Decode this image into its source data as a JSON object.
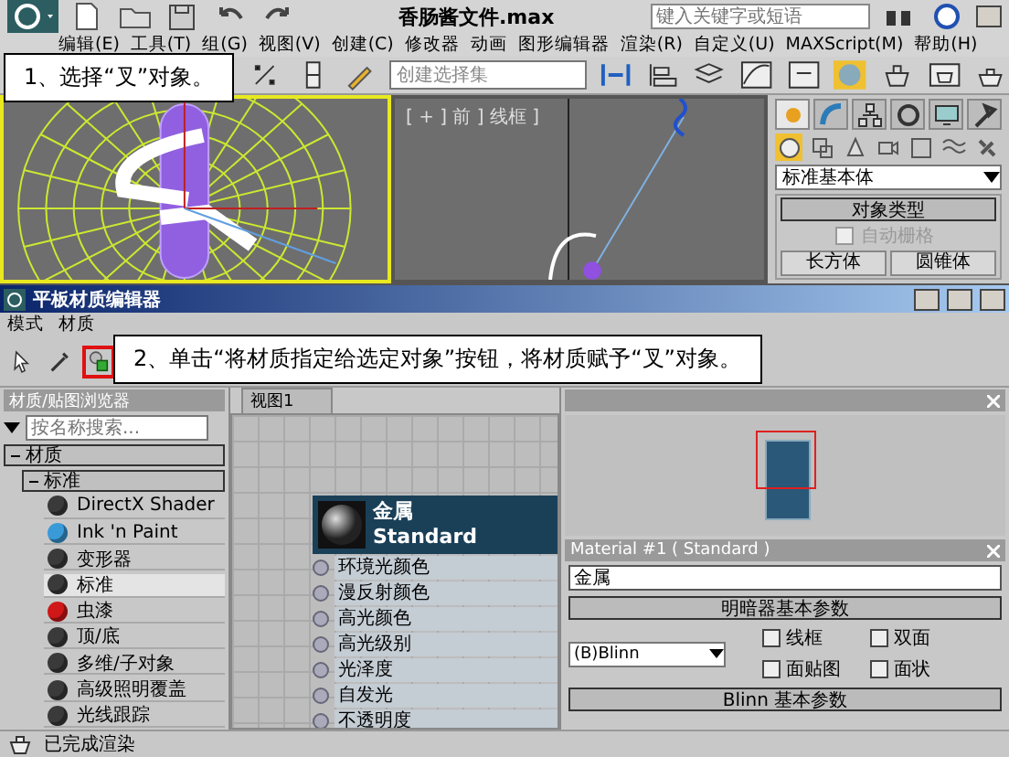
{
  "app_window": {
    "title": "香肠酱文件.max",
    "search": {
      "placeholder": "键入关键字或短语"
    },
    "menu": [
      "编辑(E)",
      "工具(T)",
      "组(G)",
      "视图(V)",
      "创建(C)",
      "修改器",
      "动画",
      "图形编辑器",
      "渲染(R)",
      "自定义(U)",
      "MAXScript(M)",
      "帮助(H)"
    ],
    "selection_set": {
      "placeholder": "创建选择集"
    }
  },
  "viewports": [
    {
      "kind": "perspective",
      "selected": true
    },
    {
      "kind": "front",
      "label": "[ + ] 前 ] 线框 ]",
      "selected": false
    }
  ],
  "command_panel": {
    "tabs": [
      {
        "kind": "create",
        "selected": true
      },
      {
        "kind": "modify",
        "selected": false
      },
      {
        "kind": "hierarchy",
        "selected": false
      },
      {
        "kind": "motion",
        "selected": false
      },
      {
        "kind": "display",
        "selected": false
      },
      {
        "kind": "utilities",
        "selected": false
      }
    ],
    "categories": [
      {
        "kind": "geometry",
        "selected": true
      },
      {
        "kind": "shapes",
        "selected": false
      },
      {
        "kind": "lights",
        "selected": false
      },
      {
        "kind": "cameras",
        "selected": false
      },
      {
        "kind": "helpers",
        "selected": false
      },
      {
        "kind": "spacewarps",
        "selected": false
      },
      {
        "kind": "systems",
        "selected": false
      }
    ],
    "dropdown": "标准基本体",
    "rollout": {
      "title": "对象类型",
      "auto_grid": {
        "label": "自动栅格",
        "checked": false,
        "disabled": true
      },
      "buttons": [
        "长方体",
        "圆锥体"
      ]
    }
  },
  "material_editor": {
    "title": "平板材质编辑器",
    "menu": [
      "模式",
      "材质"
    ],
    "toolbar": [
      {
        "kind": "select",
        "highlighted": false
      },
      {
        "kind": "picker",
        "highlighted": false
      },
      {
        "kind": "assign",
        "highlighted": true
      }
    ],
    "browser": {
      "title": "材质/贴图浏览器",
      "search": {
        "placeholder": "按名称搜索..."
      },
      "groups": [
        {
          "label": "材质",
          "expanded": true,
          "children": [
            {
              "label": "标准",
              "expanded": true,
              "children": [
                {
                  "label": "DirectX Shader",
                  "color": "#3a3a3a",
                  "selected": false
                },
                {
                  "label": "Ink 'n Paint",
                  "color": "#3a9ad8",
                  "selected": false
                },
                {
                  "label": "变形器",
                  "color": "#3a3a3a",
                  "selected": false
                },
                {
                  "label": "标准",
                  "color": "#3a3a3a",
                  "selected": true
                },
                {
                  "label": "虫漆",
                  "color": "#d01818",
                  "selected": false
                },
                {
                  "label": "顶/底",
                  "color": "#3a3a3a",
                  "selected": false
                },
                {
                  "label": "多维/子对象",
                  "color": "#3a3a3a",
                  "selected": false
                },
                {
                  "label": "高级照明覆盖",
                  "color": "#3a3a3a",
                  "selected": false
                },
                {
                  "label": "光线跟踪",
                  "color": "#3a3a3a",
                  "selected": false
                }
              ]
            }
          ]
        }
      ]
    },
    "view": {
      "tab": "视图1",
      "node": {
        "name": "金属",
        "type": "Standard",
        "slots": [
          "环境光颜色",
          "漫反射颜色",
          "高光颜色",
          "高光级别",
          "光泽度",
          "自发光",
          "不透明度"
        ]
      }
    },
    "material_params": {
      "title": "Material #1  ( Standard )",
      "name": "金属",
      "shader_rollout": {
        "title": "明暗器基本参数",
        "shader": "(B)Blinn",
        "options": [
          {
            "label": "线框",
            "checked": false
          },
          {
            "label": "双面",
            "checked": false
          },
          {
            "label": "面贴图",
            "checked": false
          },
          {
            "label": "面状",
            "checked": false
          }
        ]
      },
      "blinn_rollout": {
        "title": "Blinn 基本参数"
      }
    },
    "status": "已完成渲染"
  },
  "callouts": [
    "1、选择“叉”对象。",
    "2、单击“将材质指定给选定对象”按钮，将材质赋予“叉”对象。"
  ]
}
